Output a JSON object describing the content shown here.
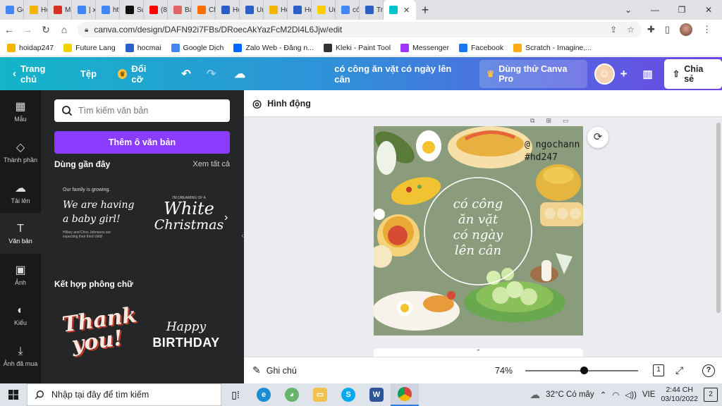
{
  "browser": {
    "tabs": [
      {
        "label": "Go",
        "color": "#4285f4"
      },
      {
        "label": "Hỏi",
        "color": "#f4b400"
      },
      {
        "label": "Ma",
        "color": "#d93025"
      },
      {
        "label": "| x",
        "color": "#4285f4"
      },
      {
        "label": "http",
        "color": "#4285f4"
      },
      {
        "label": "Suc",
        "color": "#111111"
      },
      {
        "label": "(8)",
        "color": "#ff0000"
      },
      {
        "label": "Bài",
        "color": "#e06666"
      },
      {
        "label": "Ch",
        "color": "#ff6d00"
      },
      {
        "label": "Họ",
        "color": "#2b5fc7"
      },
      {
        "label": "Un",
        "color": "#2b5fc7"
      },
      {
        "label": "Hỏi",
        "color": "#f4b400"
      },
      {
        "label": "Họ",
        "color": "#2b5fc7"
      },
      {
        "label": "Un",
        "color": "#ffcc00"
      },
      {
        "label": "có",
        "color": "#4285f4"
      },
      {
        "label": "Tra",
        "color": "#2b5fc7"
      },
      {
        "label": "",
        "color": "#00c4cc",
        "active": true
      }
    ],
    "new_tab": "+",
    "address": "canva.com/design/DAFN92i7FBs/DRoecAkYazFcM2Dl4L6Jjw/edit",
    "bookmarks": [
      {
        "label": "hoidap247",
        "color": "#f4b400"
      },
      {
        "label": "Future Lang",
        "color": "#f4d000"
      },
      {
        "label": "hocmai",
        "color": "#2b5fc7"
      },
      {
        "label": "Google Dịch",
        "color": "#4285f4"
      },
      {
        "label": "Zalo Web - Đăng n...",
        "color": "#0068ff"
      },
      {
        "label": "Kleki - Paint Tool",
        "color": "#333333"
      },
      {
        "label": "Messenger",
        "color": "#a033ff"
      },
      {
        "label": "Facebook",
        "color": "#1877f2"
      },
      {
        "label": "Scratch - Imagine,...",
        "color": "#ffab19"
      }
    ]
  },
  "canva": {
    "home": "Trang chủ",
    "file": "Tệp",
    "resize": "Đổi cỡ",
    "title": "có công ăn vặt có ngày lên cân",
    "try_pro": "Dùng thử Canva Pro",
    "share": "Chia sẻ",
    "rail": [
      {
        "label": "Mẫu",
        "icon": "layout-icon",
        "glyph": "▦"
      },
      {
        "label": "Thành phần",
        "icon": "elements-icon",
        "glyph": "◇"
      },
      {
        "label": "Tải lên",
        "icon": "upload-icon",
        "glyph": "☁"
      },
      {
        "label": "Văn bản",
        "icon": "text-icon",
        "glyph": "T",
        "active": true
      },
      {
        "label": "Ảnh",
        "icon": "photo-icon",
        "glyph": "▣"
      },
      {
        "label": "Kiểu",
        "icon": "palette-icon",
        "glyph": "◐"
      },
      {
        "label": "Ảnh đã mua",
        "icon": "download-icon",
        "glyph": "⤓"
      }
    ],
    "panel": {
      "search_placeholder": "Tìm kiếm văn bản",
      "add_text": "Thêm ô văn bản",
      "recent": "Dùng gần đây",
      "see_all": "Xem tất cả",
      "font_combos": "Kết hợp phông chữ",
      "tpl1": {
        "small": "Our family is growing.",
        "main1": "We are having",
        "main2": "a baby girl!",
        "sub1": "Hillary and Chris Johnsons are",
        "sub2": "expecting their third child!"
      },
      "tpl2": {
        "small": "I'M DREAMING OF A",
        "line1": "White",
        "line2": "Christmas"
      },
      "tpl3": {
        "line1": "Thank",
        "line2": "you!"
      },
      "tpl4": {
        "line1": "Happy",
        "line2": "BIRTHDAY"
      }
    },
    "toolbar": {
      "animate": "Hình động"
    },
    "design": {
      "handle1": "@ ngochann",
      "handle2": "#hd247",
      "circle": [
        "có công",
        "ăn vặt",
        "có ngày",
        "lên cân"
      ]
    },
    "footer": {
      "notes": "Ghi chú",
      "zoom": "74%",
      "zoom_fraction": 0.52,
      "page": "1"
    }
  },
  "taskbar": {
    "search": "Nhập tại đây để tìm kiếm",
    "weather": "32°C  Có mây",
    "lang": "VIE",
    "time": "2:44 CH",
    "date": "03/10/2022",
    "notifications": "2"
  }
}
